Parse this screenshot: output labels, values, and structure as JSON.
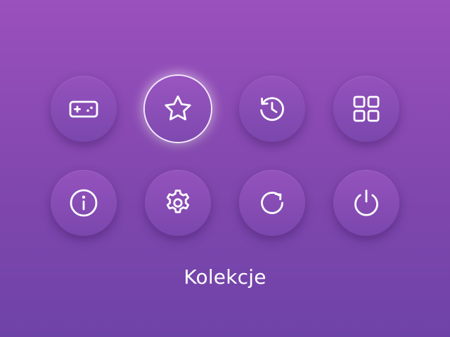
{
  "menu": {
    "items": [
      {
        "icon": "gamepad-icon",
        "selected": false
      },
      {
        "icon": "star-icon",
        "selected": true
      },
      {
        "icon": "history-icon",
        "selected": false
      },
      {
        "icon": "grid-icon",
        "selected": false
      },
      {
        "icon": "info-icon",
        "selected": false
      },
      {
        "icon": "gear-icon",
        "selected": false
      },
      {
        "icon": "refresh-icon",
        "selected": false
      },
      {
        "icon": "power-icon",
        "selected": false
      }
    ],
    "selected_label": "Kolekcje"
  },
  "colors": {
    "background_top": "#9a50bd",
    "background_bottom": "#6e43a8",
    "button": "#8a4db6",
    "icon": "#ffffff",
    "selected_ring": "#f2e8ff"
  }
}
